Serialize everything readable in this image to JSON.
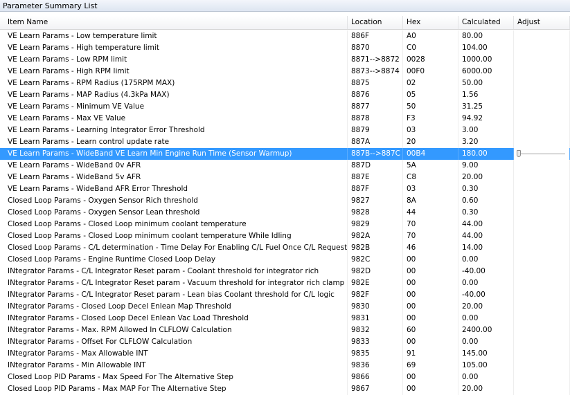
{
  "window": {
    "title": "Parameter Summary List"
  },
  "columns": [
    "Item Name",
    "Location",
    "Hex",
    "Calculated",
    "Adjust"
  ],
  "selected_row_index": 10,
  "rows": [
    {
      "name": "VE Learn Params - Low temperature limit",
      "location": "886F",
      "hex": "A0",
      "calculated": "80.00"
    },
    {
      "name": "VE Learn Params - High temperature limit",
      "location": "8870",
      "hex": "C0",
      "calculated": "104.00"
    },
    {
      "name": "VE Learn Params - Low RPM limit",
      "location": "8871-->8872",
      "hex": "0028",
      "calculated": "1000.00"
    },
    {
      "name": "VE Learn Params - High RPM limit",
      "location": "8873-->8874",
      "hex": "00F0",
      "calculated": "6000.00"
    },
    {
      "name": "VE Learn Params - RPM Radius (175RPM MAX)",
      "location": "8875",
      "hex": "02",
      "calculated": "50.00"
    },
    {
      "name": "VE Learn Params - MAP Radius (4.3kPa MAX)",
      "location": "8876",
      "hex": "05",
      "calculated": "1.56"
    },
    {
      "name": "VE Learn Params - Minimum VE Value",
      "location": "8877",
      "hex": "50",
      "calculated": "31.25"
    },
    {
      "name": "VE Learn Params - Max VE Value",
      "location": "8878",
      "hex": "F3",
      "calculated": "94.92"
    },
    {
      "name": "VE Learn Params - Learning Integrator Error Threshold",
      "location": "8879",
      "hex": "03",
      "calculated": "3.00"
    },
    {
      "name": "VE Learn Params - Learn control update rate",
      "location": "887A",
      "hex": "20",
      "calculated": "3.20"
    },
    {
      "name": "VE Learn Params - WideBand VE Learn Min Engine Run Time (Sensor Warmup)",
      "location": "887B-->887C",
      "hex": "00B4",
      "calculated": "180.00"
    },
    {
      "name": "VE Learn Params - WideBand 0v AFR",
      "location": "887D",
      "hex": "5A",
      "calculated": "9.00"
    },
    {
      "name": "VE Learn Params - WideBand 5v AFR",
      "location": "887E",
      "hex": "C8",
      "calculated": "20.00"
    },
    {
      "name": "VE Learn Params - WideBand AFR Error Threshold",
      "location": "887F",
      "hex": "03",
      "calculated": "0.30"
    },
    {
      "name": "Closed Loop Params - Oxygen Sensor Rich threshold",
      "location": "9827",
      "hex": "8A",
      "calculated": "0.60"
    },
    {
      "name": "Closed Loop Params - Oxygen Sensor Lean threshold",
      "location": "9828",
      "hex": "44",
      "calculated": "0.30"
    },
    {
      "name": "Closed Loop Params - Closed Loop minimum coolant temperature",
      "location": "9829",
      "hex": "70",
      "calculated": "44.00"
    },
    {
      "name": "Closed Loop Params - Closed Loop minimum coolant temperature While Idling",
      "location": "982A",
      "hex": "70",
      "calculated": "44.00"
    },
    {
      "name": "Closed Loop Params - C/L determination - Time Delay For Enabling C/L Fuel Once C/L Requested",
      "location": "982B",
      "hex": "46",
      "calculated": "14.00"
    },
    {
      "name": "Closed Loop Params - Engine Runtime Closed Loop Delay",
      "location": "982C",
      "hex": "00",
      "calculated": "0.00"
    },
    {
      "name": "INtegrator Params - C/L Integrator Reset param - Coolant threshold for integrator rich",
      "location": "982D",
      "hex": "00",
      "calculated": "-40.00"
    },
    {
      "name": "INtegrator Params - C/L Integrator Reset param - Vacuum threshold for integrator rich clamp",
      "location": "982E",
      "hex": "00",
      "calculated": "0.00"
    },
    {
      "name": "INtegrator Params - C/L Integrator Reset param - Lean bias Coolant threshold for C/L logic",
      "location": "982F",
      "hex": "00",
      "calculated": "-40.00"
    },
    {
      "name": "INtegrator Params - Closed Loop Decel Enlean Map Threshold",
      "location": "9830",
      "hex": "00",
      "calculated": "20.00"
    },
    {
      "name": "INtegrator Params - Closed Loop Decel Enlean Vac Load Threshold",
      "location": "9831",
      "hex": "00",
      "calculated": "0.00"
    },
    {
      "name": "INtegrator Params - Max. RPM Allowed In CLFLOW Calculation",
      "location": "9832",
      "hex": "60",
      "calculated": "2400.00"
    },
    {
      "name": "INtegrator Params - Offset For CLFLOW Calculation",
      "location": "9833",
      "hex": "00",
      "calculated": "0.00"
    },
    {
      "name": "INtegrator Params - Max Allowable INT",
      "location": "9835",
      "hex": "91",
      "calculated": "145.00"
    },
    {
      "name": "INtegrator Params - Min Allowable INT",
      "location": "9836",
      "hex": "69",
      "calculated": "105.00"
    },
    {
      "name": "Closed Loop PID Params - Max Speed For The Alternative Step",
      "location": "9866",
      "hex": "00",
      "calculated": "0.00"
    },
    {
      "name": "Closed Loop PID Params - Max MAP For The Alternative Step",
      "location": "9867",
      "hex": "00",
      "calculated": "20.00"
    }
  ],
  "adjust_slider": {
    "value_fraction": 0.0
  },
  "colors": {
    "selection": "#3399ff",
    "selection_text": "#ffffff"
  }
}
